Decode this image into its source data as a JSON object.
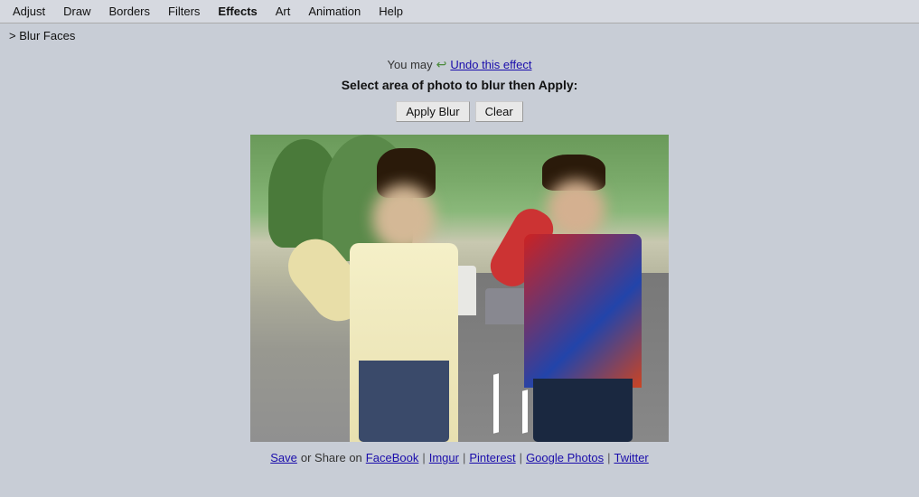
{
  "menubar": {
    "items": [
      {
        "label": "Adjust",
        "id": "adjust"
      },
      {
        "label": "Draw",
        "id": "draw"
      },
      {
        "label": "Borders",
        "id": "borders"
      },
      {
        "label": "Filters",
        "id": "filters"
      },
      {
        "label": "Effects",
        "id": "effects"
      },
      {
        "label": "Art",
        "id": "art"
      },
      {
        "label": "Animation",
        "id": "animation"
      },
      {
        "label": "Help",
        "id": "help"
      }
    ]
  },
  "breadcrumb": "> Blur Faces",
  "undo": {
    "prefix": "You may",
    "link_text": "Undo this effect",
    "icon": "↩"
  },
  "instruction": "Select area of photo to blur then Apply:",
  "buttons": {
    "apply_blur": "Apply Blur",
    "clear": "Clear"
  },
  "share": {
    "text": "or Share on",
    "save_label": "Save",
    "links": [
      "FaceBook",
      "Imgur",
      "Pinterest",
      "Google Photos",
      "Twitter"
    ],
    "separators": [
      "|",
      "|",
      "|",
      "|"
    ]
  }
}
